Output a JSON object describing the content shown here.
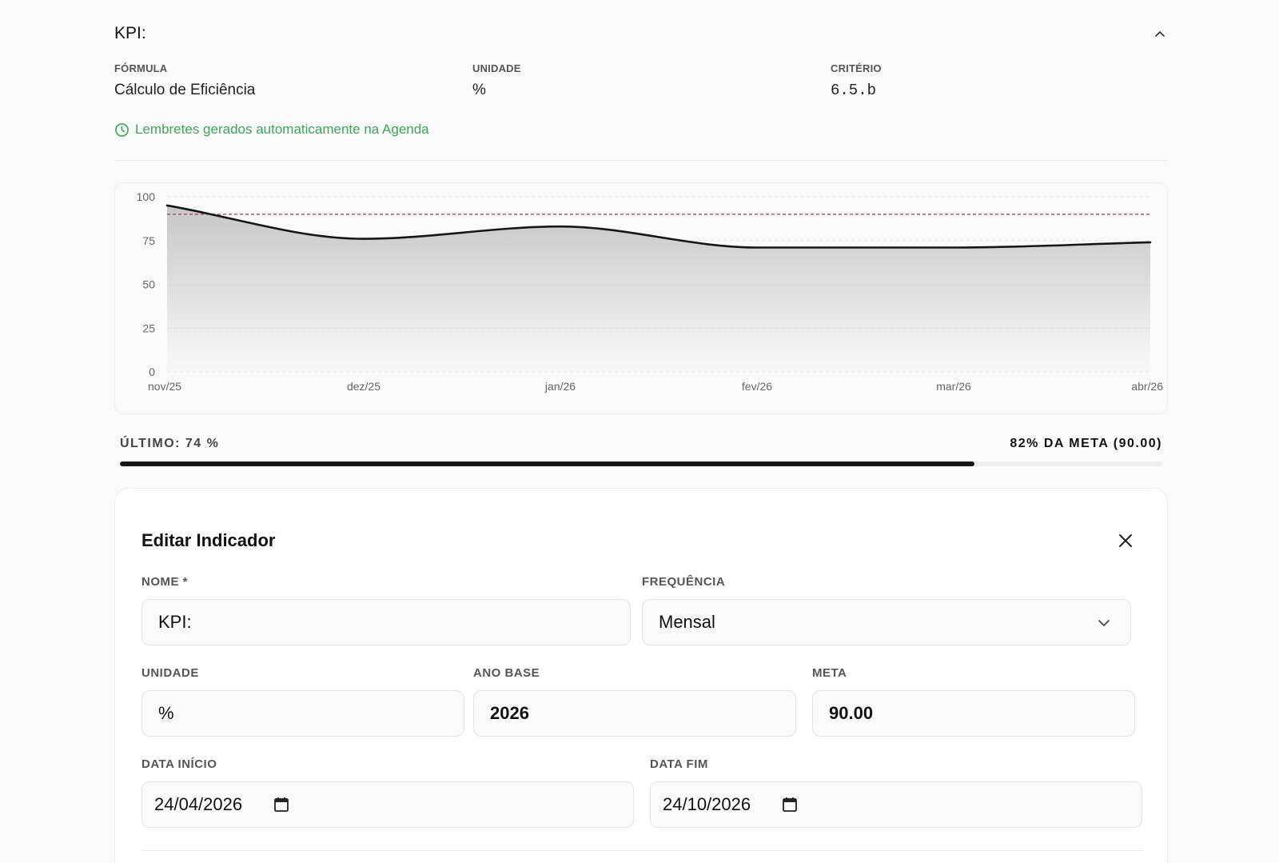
{
  "header": {
    "title": "KPI:",
    "collapse_icon": "chevron-up-icon"
  },
  "details": {
    "formula_label": "FÓRMULA",
    "formula_value": "Cálculo de Eficiência",
    "unit_label": "UNIDADE",
    "unit_value": "%",
    "criterion_label": "CRITÉRIO",
    "criterion_value": "6.5.b"
  },
  "reminder": {
    "icon": "clock-icon",
    "text": "Lembretes gerados automaticamente na Agenda",
    "color": "#3aa65a"
  },
  "chart_data": {
    "type": "area",
    "categories": [
      "nov/25",
      "dez/25",
      "jan/26",
      "fev/26",
      "mar/26",
      "abr/26"
    ],
    "series": [
      {
        "values": [
          95,
          76,
          83,
          71,
          71,
          74
        ],
        "color": "#161616"
      }
    ],
    "target": {
      "value": 90,
      "color": "#b33a3a",
      "style": "dashed"
    },
    "ylim": [
      0,
      100
    ],
    "yticks": [
      0,
      25,
      50,
      75,
      100
    ],
    "grid": true
  },
  "progress": {
    "last_label": "ÚLTIMO: 74 %",
    "goal_label": "82% DA META (90.00)",
    "fraction": 0.82
  },
  "edit": {
    "title": "Editar Indicador",
    "close_icon": "close-icon",
    "name_label": "NOME *",
    "name_value": "KPI:",
    "frequency_label": "FREQUÊNCIA",
    "frequency_value": "Mensal",
    "unit_label": "UNIDADE",
    "unit_value": "%",
    "base_year_label": "ANO BASE",
    "base_year_value": "2026",
    "goal_label": "META",
    "goal_value": "90.00",
    "start_label": "DATA INÍCIO",
    "start_value": "24/04/2026",
    "end_label": "DATA FIM",
    "end_value": "24/10/2026"
  }
}
